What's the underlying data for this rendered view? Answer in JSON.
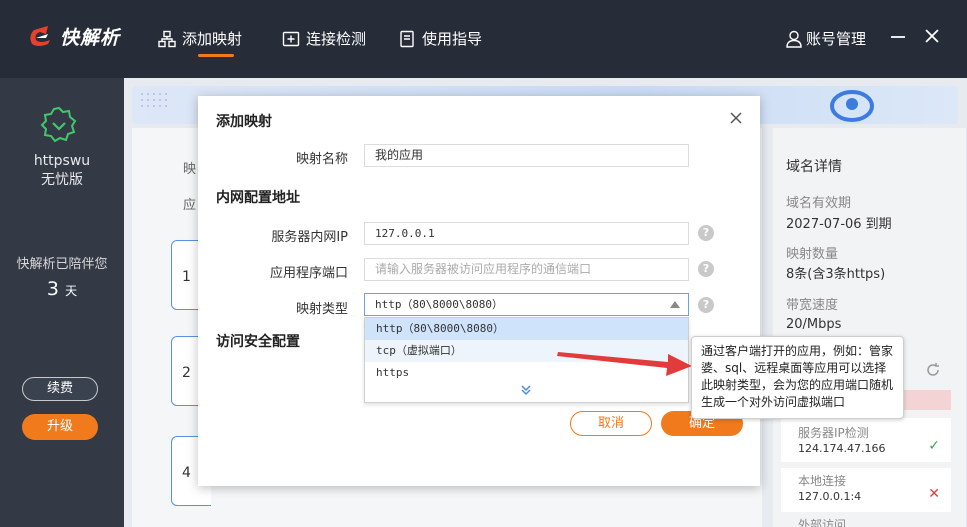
{
  "app": {
    "name": "快解析"
  },
  "nav": {
    "items": [
      {
        "label": "添加映射",
        "icon": "network-icon"
      },
      {
        "label": "连接检测",
        "icon": "plus-square-icon"
      },
      {
        "label": "使用指导",
        "icon": "document-icon"
      }
    ],
    "account_label": "账号管理"
  },
  "sidebar": {
    "user_line1": "httpswu",
    "user_line2": "无忧版",
    "days_label": "快解析已陪伴您",
    "days_value": "3",
    "days_unit": "天",
    "renew_label": "续费",
    "upgrade_label": "升级"
  },
  "background": {
    "frag1": "映",
    "frag2": "应",
    "rows": [
      "1",
      "2",
      "4"
    ],
    "right_panel": {
      "title": "域名详情",
      "expiry_label": "域名有效期",
      "expiry_value": "2027-07-06 到期",
      "count_label": "映射数量",
      "count_value": "8条(含3条https)",
      "bandwidth_label": "带宽速度",
      "bandwidth_value": "20/Mbps",
      "server_ip_label": "服务器IP检测",
      "server_ip_value": "124.174.47.166",
      "local_label": "本地连接",
      "local_value": "127.0.0.1:4",
      "external_label": "外部访问"
    }
  },
  "dialog": {
    "title": "添加映射",
    "name_label": "映射名称",
    "name_value": "我的应用",
    "section_internal": "内网配置地址",
    "server_ip_label": "服务器内网IP",
    "server_ip_value": "127.0.0.1",
    "port_label": "应用程序端口",
    "port_placeholder": "请输入服务器被访问应用程序的通信端口",
    "type_label": "映射类型",
    "type_value": "http（80\\8000\\8080）",
    "type_options": [
      "http（80\\8000\\8080）",
      "tcp（虚拟端口）",
      "https"
    ],
    "section_security": "访问安全配置",
    "cancel_label": "取消",
    "ok_label": "确定"
  },
  "tooltip": {
    "text": "通过客户端打开的应用，例如：管家婆、sql、远程桌面等应用可以选择此映射类型，会为您的应用端口随机生成一个对外访问虚拟端口"
  },
  "colors": {
    "accent": "#f07a1c",
    "topbar": "#262d38",
    "sidebar": "#333a46",
    "select_border": "#6aa1e8"
  }
}
